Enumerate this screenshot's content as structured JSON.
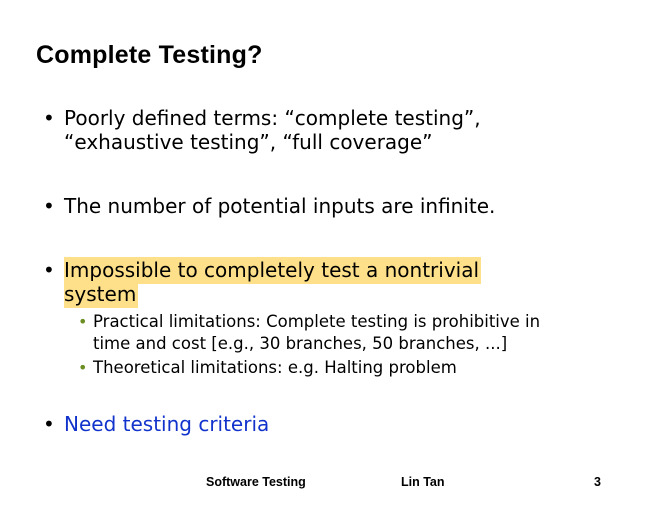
{
  "slide": {
    "title": "Complete Testing?",
    "bullets": [
      {
        "lines": [
          "Poorly defined terms: “complete testing”,",
          "“exhaustive testing”, “full coverage”"
        ]
      },
      {
        "text": "The number of potential inputs are infinite."
      },
      {
        "lines": [
          "Impossible to completely test a nontrivial",
          "system"
        ],
        "highlight_color": "#ffe08a",
        "sub_bullets": [
          {
            "lines": [
              "Practical limitations: Complete testing is prohibitive in",
              "time and cost [e.g., 30 branches, 50 branches, ...]"
            ]
          },
          {
            "text": "Theoretical limitations: e.g. Halting problem"
          }
        ]
      },
      {
        "text": "Need testing criteria",
        "color": "#1133cc"
      }
    ],
    "bullet_symbol": "•",
    "sub_bullet_color": "#6b8e23"
  },
  "footer": {
    "course": "Software Testing",
    "author": "Lin Tan",
    "page_number": "3"
  }
}
